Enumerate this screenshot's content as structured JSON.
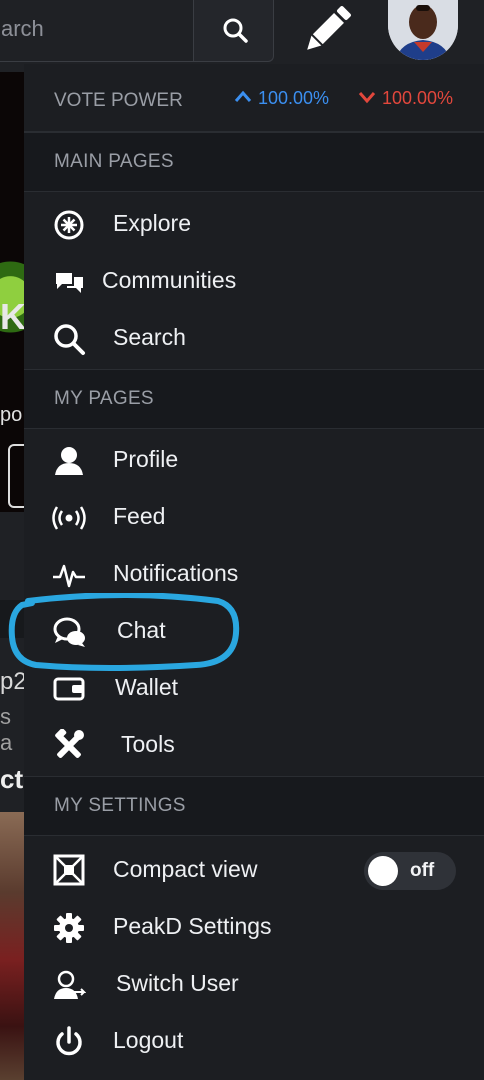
{
  "header": {
    "search_placeholder": "arch",
    "icons": [
      "search-icon",
      "pencil-icon",
      "avatar"
    ]
  },
  "background_page": {
    "k_glyph": "Kw",
    "text1": "po",
    "text2": "p2",
    "text3": "s a",
    "text4": "cti"
  },
  "vote_power": {
    "label": "VOTE POWER",
    "up_value": "100.00%",
    "down_value": "100.00%",
    "up_color": "#3b8ff0",
    "down_color": "#e2473c"
  },
  "sections": {
    "main_pages": "MAIN PAGES",
    "my_pages": "MY PAGES",
    "my_settings": "MY SETTINGS"
  },
  "main_pages": [
    {
      "label": "Explore",
      "icon": "explore-icon"
    },
    {
      "label": "Communities",
      "icon": "communities-icon"
    },
    {
      "label": "Search",
      "icon": "search-icon"
    }
  ],
  "my_pages": [
    {
      "label": "Profile",
      "icon": "profile-icon"
    },
    {
      "label": "Feed",
      "icon": "feed-icon"
    },
    {
      "label": "Notifications",
      "icon": "notifications-icon"
    },
    {
      "label": "Chat",
      "icon": "chat-icon"
    },
    {
      "label": "Wallet",
      "icon": "wallet-icon"
    },
    {
      "label": "Tools",
      "icon": "tools-icon"
    }
  ],
  "my_settings": [
    {
      "label": "Compact view",
      "icon": "compact-view-icon",
      "toggle": "off"
    },
    {
      "label": "PeakD Settings",
      "icon": "settings-icon"
    },
    {
      "label": "Switch User",
      "icon": "switch-user-icon"
    },
    {
      "label": "Logout",
      "icon": "logout-icon"
    }
  ],
  "annotation_color": "#2aa7e0"
}
